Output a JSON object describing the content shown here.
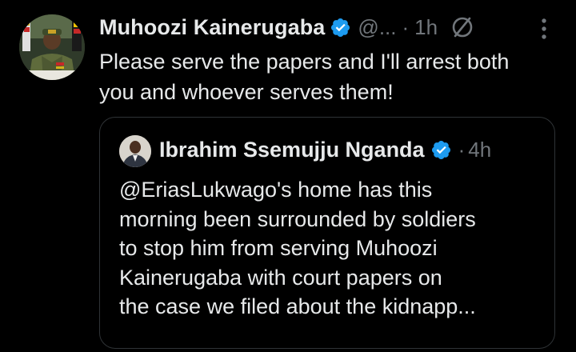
{
  "tweet": {
    "author_name": "Muhoozi Kainerugaba",
    "handle": "@...",
    "separator": "·",
    "time": "1h",
    "text": "Please serve the papers and I'll arrest both you and whoever serves them!",
    "icons": {
      "verified": "verified-badge-icon",
      "no_sign": "no-sign-icon",
      "more": "more-options-icon"
    },
    "colors": {
      "verified_blue": "#1d9bf0",
      "secondary_text": "#71767b",
      "primary_text": "#e7e9ea",
      "background": "#000000",
      "border": "#2f3336"
    }
  },
  "quoted_tweet": {
    "author_name": "Ibrahim Ssemujju Nganda",
    "separator": "·",
    "time": "4h",
    "text": "@EriasLukwago's home has this\nmorning been surrounded by soldiers\nto stop him from serving  Muhoozi\nKainerugaba with court papers on\nthe case we filed about the kidnapp..."
  }
}
